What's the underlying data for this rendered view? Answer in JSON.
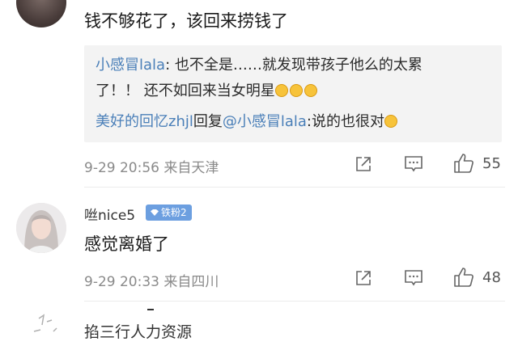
{
  "comment1": {
    "text": "钱不够花了，该回来捞钱了",
    "replies": {
      "reply1_user": "小感冒lala",
      "reply1_text_a": ": 也不全是……就发现带孩子他么的太累",
      "reply1_text_b": "了！！ 还不如回来当女明星",
      "reply2_user": "美好的回忆zhjl",
      "reply2_mid": "回复",
      "reply2_mention": "@小感冒lala",
      "reply2_text": ":说的也很对"
    },
    "meta": "9-29 20:56  来自天津",
    "likes": "55"
  },
  "comment2": {
    "username": "咝nice5",
    "badge": "铁粉2",
    "text": "感觉离婚了",
    "meta": "9-29 20:33  来自四川",
    "likes": "48"
  },
  "comment3": {
    "text": "掐三行人力资源"
  },
  "colors": {
    "link_blue": "#4a7fb8",
    "badge_blue": "#6c9fe0",
    "reply_bg": "#f3f3f3",
    "meta_gray": "#8a8a8a"
  },
  "icons": [
    "share-icon",
    "comment-icon",
    "like-icon",
    "gem-icon",
    "laugh-emoji-icon",
    "grin-emoji-icon"
  ]
}
